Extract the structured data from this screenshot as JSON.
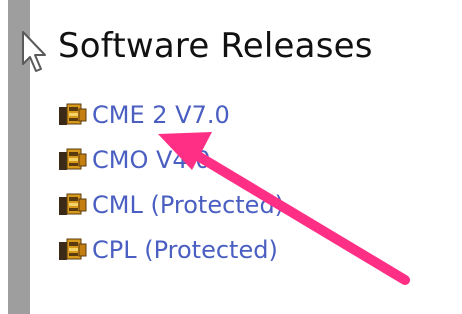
{
  "header": {
    "title": "Software Releases"
  },
  "releases": {
    "items": [
      {
        "label": "CME 2 V7.0"
      },
      {
        "label": "CMO V4.0"
      },
      {
        "label": "CML (Protected)"
      },
      {
        "label": "CPL (Protected)"
      }
    ]
  },
  "icons": {
    "release": "package-icon",
    "cursor": "mouse-pointer-icon",
    "annotation": "annotation-arrow"
  },
  "colors": {
    "link": "#4a5fc1",
    "title": "#111111",
    "sidebar_bar": "#9e9e9e",
    "annotation_arrow": "#ff2f86"
  }
}
